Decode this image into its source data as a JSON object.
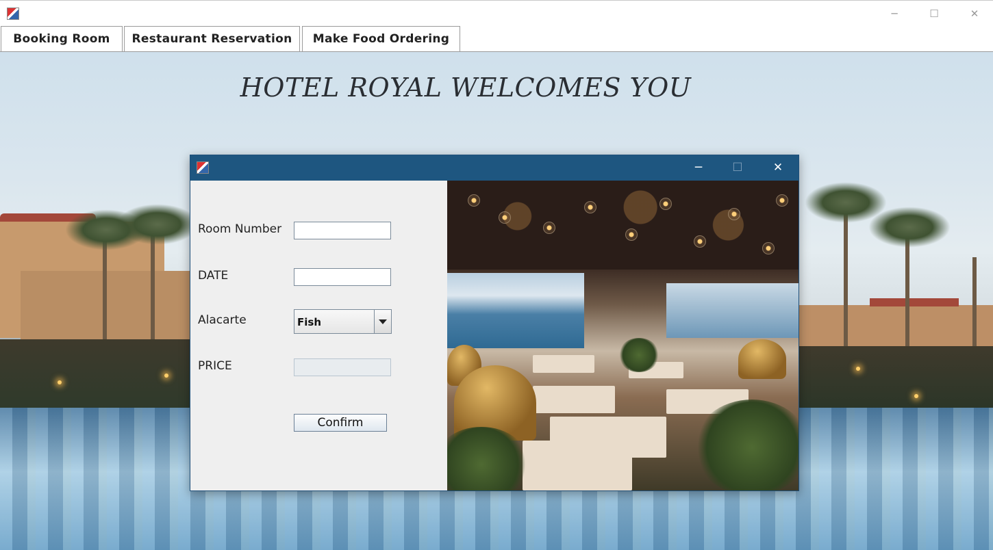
{
  "window": {
    "minimize_glyph": "─",
    "maximize_glyph": "☐",
    "close_glyph": "✕"
  },
  "tabs": [
    {
      "label": "Booking Room"
    },
    {
      "label": "Restaurant Reservation"
    },
    {
      "label": "Make Food Ordering"
    }
  ],
  "heading": "HOTEL ROYAL WELCOMES YOU",
  "dialog": {
    "minimize_glyph": "─",
    "maximize_glyph": "☐",
    "close_glyph": "✕",
    "form": {
      "room_number": {
        "label": "Room Number",
        "value": ""
      },
      "date": {
        "label": "DATE",
        "value": ""
      },
      "alacarte": {
        "label": "Alacarte",
        "selected": "Fish"
      },
      "price": {
        "label": "PRICE",
        "value": ""
      },
      "confirm_label": "Confirm"
    }
  },
  "colors": {
    "dialog_titlebar": "#1e5680",
    "dialog_background": "#efefef"
  },
  "icons": {
    "app": "java-app-icon",
    "combo_arrow": "triangle-down-icon"
  }
}
